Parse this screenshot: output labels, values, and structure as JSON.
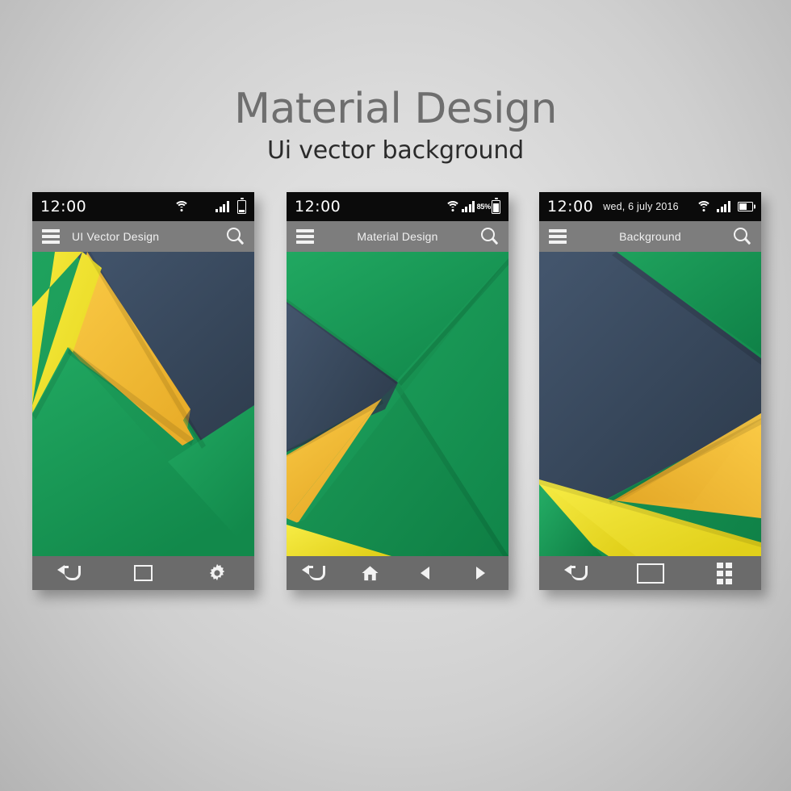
{
  "header": {
    "title": "Material Design",
    "subtitle": "Ui vector background"
  },
  "palette": {
    "green": "#189B55",
    "green_dark": "#0F7F44",
    "navy": "#3B4C60",
    "navy_dark": "#2E3C4D",
    "amber": "#F5C13A",
    "amber_dark": "#E0A82A",
    "yellow": "#F2E32B",
    "yellow_dark": "#DBCB1E",
    "statusbar_bg": "#0B0B0B",
    "appbar_bg": "#7D7D7D",
    "navbar_bg": "#6B6B6B",
    "icon": "#F2F2F2",
    "page_bg": "#DEDEDE"
  },
  "phones": [
    {
      "id": "phone-1",
      "status": {
        "time": "12:00",
        "date": "",
        "battery_percent": "",
        "icons": [
          "wifi-icon",
          "signal-icon",
          "battery-icon"
        ]
      },
      "appbar": {
        "menu_icon": "hamburger-icon",
        "title": "UI Vector Design",
        "search_icon": "search-icon"
      },
      "nav": [
        {
          "name": "back-button",
          "icon": "back-arrow-icon"
        },
        {
          "name": "recents-button",
          "icon": "square-icon"
        },
        {
          "name": "settings-button",
          "icon": "gear-icon"
        }
      ]
    },
    {
      "id": "phone-2",
      "status": {
        "time": "12:00",
        "date": "",
        "battery_percent": "85%",
        "icons": [
          "wifi-icon",
          "signal-icon",
          "battery-icon"
        ]
      },
      "appbar": {
        "menu_icon": "hamburger-icon",
        "title": "Material Design",
        "search_icon": "search-icon"
      },
      "nav": [
        {
          "name": "back-button",
          "icon": "back-arrow-icon"
        },
        {
          "name": "home-button",
          "icon": "home-icon"
        },
        {
          "name": "previous-button",
          "icon": "triangle-left-icon"
        },
        {
          "name": "next-button",
          "icon": "triangle-right-icon"
        }
      ]
    },
    {
      "id": "phone-3",
      "status": {
        "time": "12:00",
        "date": "wed, 6 july 2016",
        "battery_percent": "",
        "icons": [
          "wifi-icon",
          "signal-icon",
          "battery-icon"
        ]
      },
      "appbar": {
        "menu_icon": "hamburger-icon",
        "title": "Background",
        "search_icon": "search-icon"
      },
      "nav": [
        {
          "name": "back-button",
          "icon": "back-arrow-icon"
        },
        {
          "name": "recents-button",
          "icon": "square-icon"
        },
        {
          "name": "apps-button",
          "icon": "grid-icon"
        }
      ]
    }
  ]
}
